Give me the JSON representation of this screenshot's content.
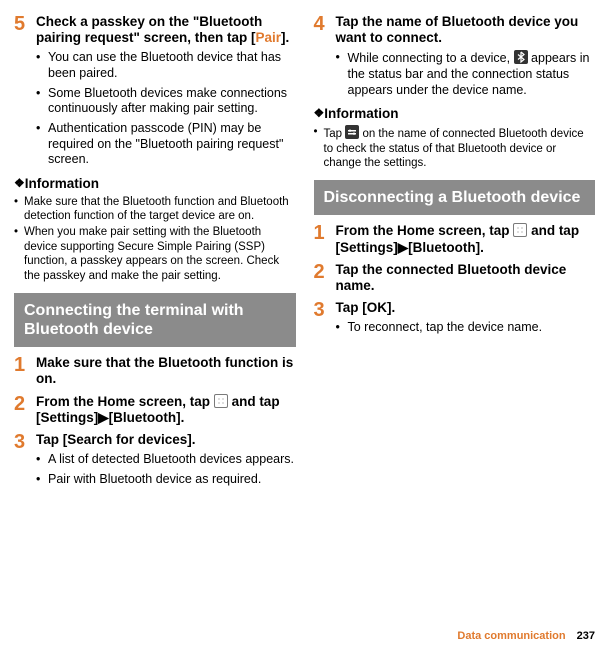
{
  "left": {
    "steps": [
      {
        "num": "5",
        "title_pre": "Check a passkey on the \"Bluetooth pairing request\" screen, then tap [",
        "title_accent": "Pair",
        "title_post": "].",
        "subs": [
          "You can use the Bluetooth device that has been paired.",
          "Some Bluetooth devices make connections continuously after making pair setting.",
          "Authentication passcode (PIN) may be required on the \"Bluetooth pairing request\" screen."
        ]
      }
    ],
    "info_header": "Information",
    "info_items": [
      "Make sure that the Bluetooth function and Bluetooth detection function of the target device are on.",
      "When you make pair setting with the Bluetooth device supporting Secure Simple Pairing (SSP) function, a passkey appears on the screen. Check the passkey and make the pair setting."
    ],
    "section": "Connecting the terminal with Bluetooth device",
    "steps2": [
      {
        "num": "1",
        "title": "Make sure that the Bluetooth function is on.",
        "subs": []
      },
      {
        "num": "2",
        "title_pre": "From the Home screen, tap ",
        "title_post_a": " and tap [Settings]",
        "arrow": "▶",
        "title_post_b": "[Bluetooth].",
        "subs": []
      },
      {
        "num": "3",
        "title": "Tap [Search for devices].",
        "subs": [
          "A list of detected Bluetooth devices appears.",
          "Pair with Bluetooth device as required."
        ]
      }
    ]
  },
  "right": {
    "steps": [
      {
        "num": "4",
        "title": "Tap the name of Bluetooth device you want to connect.",
        "sub_pre": "While connecting to a device, ",
        "sub_post": " appears in the status bar and the connection status appears under the device name."
      }
    ],
    "info_header": "Information",
    "info_pre": "Tap ",
    "info_post": " on the name of connected Bluetooth device to check the status of that Bluetooth device or change the settings.",
    "section": "Disconnecting a Bluetooth device",
    "steps2": [
      {
        "num": "1",
        "title_pre": "From the Home screen, tap ",
        "title_post_a": " and tap [Settings]",
        "arrow": "▶",
        "title_post_b": "[Bluetooth].",
        "subs": []
      },
      {
        "num": "2",
        "title": "Tap the connected Bluetooth device name.",
        "subs": []
      },
      {
        "num": "3",
        "title": "Tap [OK].",
        "subs": [
          "To reconnect, tap the device name."
        ]
      }
    ]
  },
  "footer": {
    "section": "Data communication",
    "page": "237"
  }
}
